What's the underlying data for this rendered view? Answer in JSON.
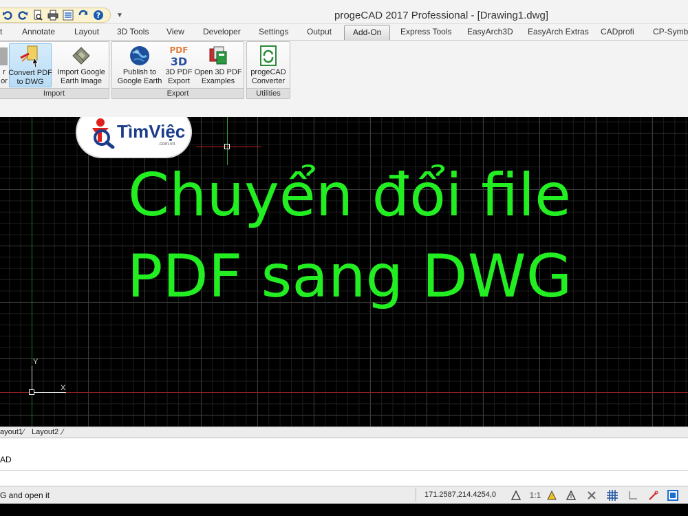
{
  "app": {
    "title": "progeCAD 2017 Professional - [Drawing1.dwg]"
  },
  "ribbon_tabs": [
    {
      "label": "t"
    },
    {
      "label": "Annotate"
    },
    {
      "label": "Layout"
    },
    {
      "label": "3D Tools"
    },
    {
      "label": "View"
    },
    {
      "label": "Developer"
    },
    {
      "label": "Settings"
    },
    {
      "label": "Output"
    },
    {
      "label": "Add-On",
      "active": true
    },
    {
      "label": "Express Tools"
    },
    {
      "label": "EasyArch3D"
    },
    {
      "label": "EasyArch Extras"
    },
    {
      "label": "CADprofi"
    },
    {
      "label": "CP-Symbo"
    }
  ],
  "panels": {
    "import": {
      "label": "Import",
      "buttons": [
        {
          "label": "r\nor",
          "icon": "partial-icon"
        },
        {
          "label": "Convert PDF\nto DWG",
          "icon": "pdf-convert-icon"
        },
        {
          "label": "Import Google\nEarth Image",
          "icon": "google-earth-import-icon"
        }
      ]
    },
    "export": {
      "label": "Export",
      "buttons": [
        {
          "label": "Publish to\nGoogle Earth",
          "icon": "globe-icon"
        },
        {
          "label": "3D PDF\nExport",
          "icon": "pdf-3d-icon"
        },
        {
          "label": "Open 3D PDF\nExamples",
          "icon": "examples-icon"
        }
      ]
    },
    "utilities": {
      "label": "Utilities",
      "buttons": [
        {
          "label": "progeCAD\nConverter",
          "icon": "converter-icon"
        }
      ]
    }
  },
  "canvas": {
    "headline_line1": "Chuyển đổi file",
    "headline_line2": "PDF sang DWG",
    "logo_text": "TìmViệc",
    "logo_sub": ".com.vn",
    "ucs_x": "X",
    "ucs_y": "Y"
  },
  "layout_tabs": [
    "ayout1",
    "Layout2"
  ],
  "command": {
    "line1": "AD"
  },
  "status": {
    "message": "G and open it",
    "coordinates": "171.2587,214.4254,0",
    "scale": "1:1"
  },
  "colors": {
    "headline": "#22ee22",
    "canvas_bg": "#000000",
    "ribbon_bg": "#f3f3f3"
  }
}
